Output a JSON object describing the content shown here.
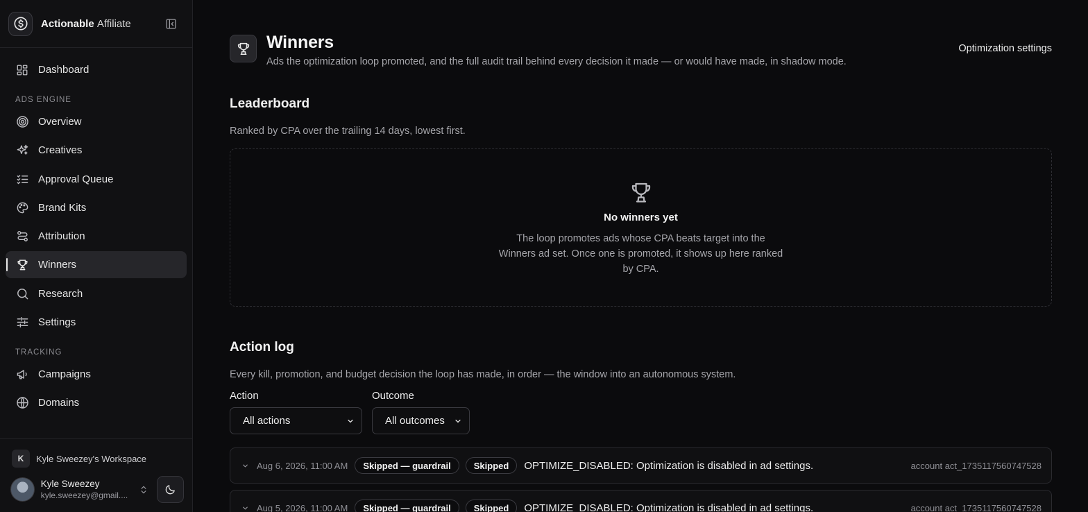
{
  "brand": {
    "name_bold": "Actionable",
    "name_light": "Affiliate"
  },
  "nav": {
    "dashboard": "Dashboard",
    "section_ads": "ADS ENGINE",
    "ads_items": [
      "Overview",
      "Creatives",
      "Approval Queue",
      "Brand Kits",
      "Attribution",
      "Winners",
      "Research",
      "Settings"
    ],
    "section_tracking": "TRACKING",
    "tracking_items": [
      "Campaigns",
      "Domains"
    ]
  },
  "workspace": {
    "initial": "K",
    "name": "Kyle Sweezey's Workspace"
  },
  "user": {
    "name": "Kyle Sweezey",
    "email": "kyle.sweezey@gmail...."
  },
  "header": {
    "title": "Winners",
    "subtitle": "Ads the optimization loop promoted, and the full audit trail behind every decision it made — or would have made, in shadow mode.",
    "settings_link": "Optimization settings"
  },
  "leaderboard": {
    "title": "Leaderboard",
    "description": "Ranked by CPA over the trailing 14 days, lowest first.",
    "empty_title": "No winners yet",
    "empty_desc": "The loop promotes ads whose CPA beats target into the Winners ad set. Once one is promoted, it shows up here ranked by CPA."
  },
  "action_log": {
    "title": "Action log",
    "description": "Every kill, promotion, and budget decision the loop has made, in order — the window into an autonomous system.",
    "filter_action_label": "Action",
    "filter_action_value": "All actions",
    "filter_outcome_label": "Outcome",
    "filter_outcome_value": "All outcomes",
    "rows": [
      {
        "date": "Aug 6, 2026, 11:00 AM",
        "action": "Skipped — guardrail",
        "outcome": "Skipped",
        "message": "OPTIMIZE_DISABLED: Optimization is disabled in ad settings.",
        "account": "account act_1735117560747528"
      },
      {
        "date": "Aug 5, 2026, 11:00 AM",
        "action": "Skipped — guardrail",
        "outcome": "Skipped",
        "message": "OPTIMIZE_DISABLED: Optimization is disabled in ad settings.",
        "account": "account act_1735117560747528"
      }
    ]
  }
}
